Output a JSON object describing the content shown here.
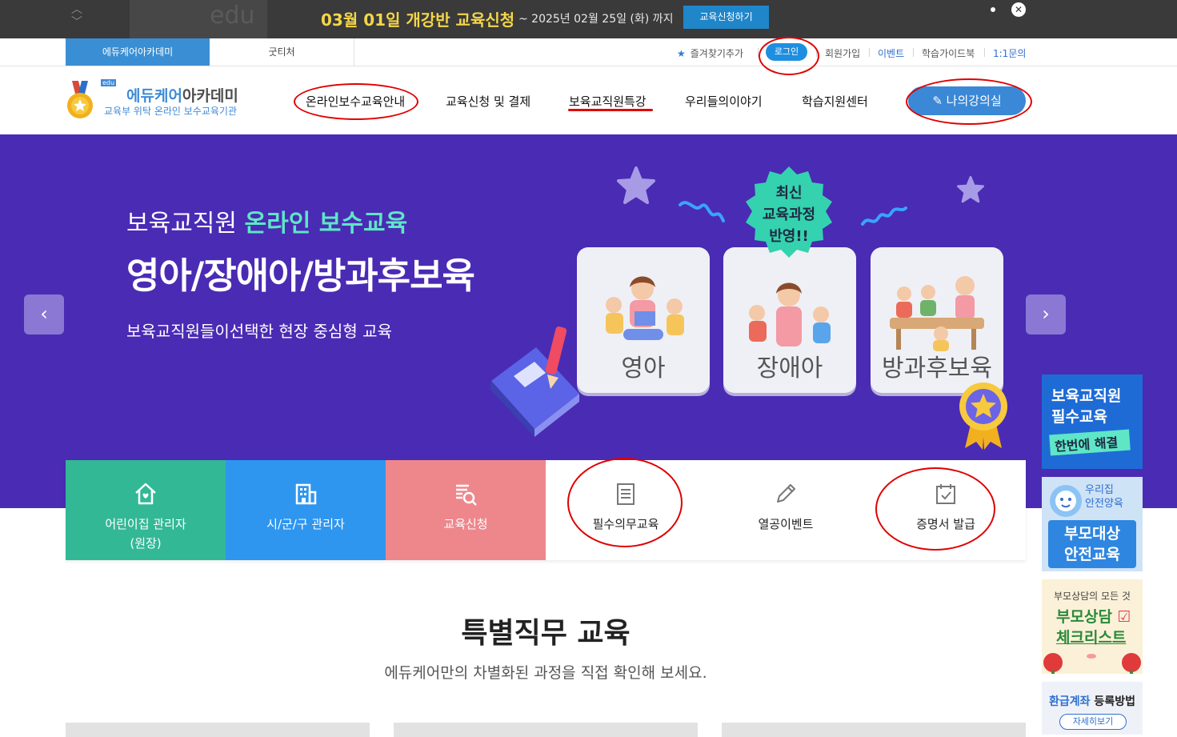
{
  "notice": {
    "headline": "03월 01일 개강반 교육신청",
    "until": "~ 2025년 02월 25일 (화) 까지",
    "apply_label": "교육신청하기",
    "ghost_text": "edu"
  },
  "util": {
    "site_tabs": [
      "에듀케어아카데미",
      "굿티처"
    ],
    "favorite_label": "즐겨찾기추가",
    "login_label": "로그인",
    "links": [
      "회원가입",
      "이벤트",
      "학습가이드북",
      "1:1문의"
    ]
  },
  "header": {
    "logo_top_blue": "에듀케어",
    "logo_top_dark": "아카데미",
    "logo_small": "edu",
    "logo_sub": "교육부 위탁 온라인 보수교육기관",
    "gnb": [
      "온라인보수교육안내",
      "교육신청 및 결제",
      "보육교직원특강",
      "우리들의이야기",
      "학습지원센터"
    ],
    "my_class_label": "나의강의실"
  },
  "hero": {
    "line1_plain": "보육교직원 ",
    "line1_accent": "온라인 보수교육",
    "line2": "영아/장애아/방과후보육",
    "line3": "보육교직원들이선택한 현장 중심형 교육",
    "badge_lines": [
      "최신",
      "교육과정",
      "반영!!"
    ],
    "cards": [
      "영아",
      "장애아",
      "방과후보육"
    ],
    "prev": "‹",
    "next": "›"
  },
  "quick": {
    "items": [
      {
        "label": "어린이집 관리자\n(원장)",
        "icon": "home-icon",
        "bg": "#33b896",
        "fg": "#ffffff"
      },
      {
        "label": "시/군/구 관리자",
        "icon": "building-icon",
        "bg": "#2e96ef",
        "fg": "#ffffff"
      },
      {
        "label": "교육신청",
        "icon": "search-list-icon",
        "bg": "#ee878c",
        "fg": "#ffffff"
      },
      {
        "label": "필수의무교육",
        "icon": "document-icon",
        "bg": "#ffffff",
        "fg": "#222222"
      },
      {
        "label": "열공이벤트",
        "icon": "pencil-icon",
        "bg": "#ffffff",
        "fg": "#222222"
      },
      {
        "label": "증명서 발급",
        "icon": "calendar-check-icon",
        "bg": "#ffffff",
        "fg": "#222222"
      }
    ]
  },
  "section": {
    "title": "특별직무 교육",
    "subtitle": "에듀케어만의 차별화된 과정을 직접 확인해 보세요."
  },
  "side": {
    "b1": {
      "line1": "보육교직원",
      "line2": "필수교육",
      "line3": "한번에 해결"
    },
    "b2": {
      "line1": "우리집",
      "line2": "안전양육",
      "line3": "부모대상",
      "line4": "안전교육"
    },
    "b3": {
      "line1": "부모상담의 모든 것",
      "line2": "부모상담",
      "line3": "체크리스트"
    },
    "b4": {
      "line1_blue": "환급계좌",
      "line1_dark": " 등록방법",
      "btn": "자세히보기"
    }
  },
  "colors": {
    "hero_bg": "#4a2bb4",
    "accent_teal": "#5ee6c6",
    "brand_blue": "#3a88d6",
    "annotation_red": "#e00000"
  }
}
